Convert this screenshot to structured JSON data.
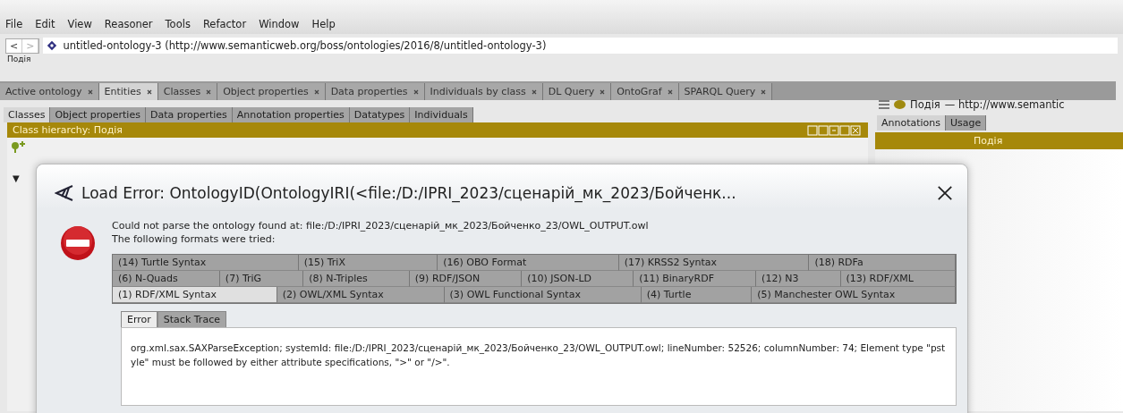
{
  "menu": [
    "File",
    "Edit",
    "View",
    "Reasoner",
    "Tools",
    "Refactor",
    "Window",
    "Help"
  ],
  "nav": {
    "back": "<",
    "forward": ">",
    "ontology": "untitled-ontology-3 (http://www.semanticweb.org/boss/ontologies/2016/8/untitled-ontology-3)",
    "breadcrumb": "Подія"
  },
  "tabs": [
    {
      "label": "Active ontology",
      "selected": false
    },
    {
      "label": "Entities",
      "selected": true
    },
    {
      "label": "Classes",
      "selected": false
    },
    {
      "label": "Object properties",
      "selected": false
    },
    {
      "label": "Data properties",
      "selected": false
    },
    {
      "label": "Individuals by class",
      "selected": false
    },
    {
      "label": "DL Query",
      "selected": false
    },
    {
      "label": "OntoGraf",
      "selected": false
    },
    {
      "label": "SPARQL Query",
      "selected": false
    }
  ],
  "subtabs": [
    {
      "label": "Classes",
      "selected": true
    },
    {
      "label": "Object properties",
      "selected": false
    },
    {
      "label": "Data properties",
      "selected": false
    },
    {
      "label": "Annotation properties",
      "selected": false
    },
    {
      "label": "Datatypes",
      "selected": false
    },
    {
      "label": "Individuals",
      "selected": false
    }
  ],
  "class_hierarchy": {
    "title": "Class hierarchy: Подія",
    "toggle": "▼"
  },
  "entity": {
    "name": "Подія",
    "iri": "— http://www.semantic",
    "color": "#a08a10"
  },
  "annotation_tabs": [
    {
      "label": "Annotations",
      "selected": true
    },
    {
      "label": "Usage",
      "selected": false
    }
  ],
  "annotation_header": "Подія",
  "dialog": {
    "title": "Load Error: OntologyID(OntologyIRI(<file:/D:/IPRI_2023/сценарій_мк_2023/Бойченк...",
    "message": [
      "Could not parse the ontology found at: file:/D:/IPRI_2023/сценарій_мк_2023/Бойченко_23/OWL_OUTPUT.owl",
      "The following formats were tried:"
    ],
    "format_rows": [
      [
        {
          "label": "(14) Turtle Syntax",
          "selected": false
        },
        {
          "label": "(15) TriX",
          "selected": false
        },
        {
          "label": "(16) OBO Format",
          "selected": false
        },
        {
          "label": "(17) KRSS2 Syntax",
          "selected": false
        },
        {
          "label": "(18) RDFa",
          "selected": false
        }
      ],
      [
        {
          "label": "(6) N-Quads",
          "selected": false
        },
        {
          "label": "(7) TriG",
          "selected": false
        },
        {
          "label": "(8) N-Triples",
          "selected": false
        },
        {
          "label": "(9) RDF/JSON",
          "selected": false
        },
        {
          "label": "(10) JSON-LD",
          "selected": false
        },
        {
          "label": "(11) BinaryRDF",
          "selected": false
        },
        {
          "label": "(12) N3",
          "selected": false
        },
        {
          "label": "(13) RDF/XML",
          "selected": false
        }
      ],
      [
        {
          "label": "(1) RDF/XML Syntax",
          "selected": true
        },
        {
          "label": "(2) OWL/XML Syntax",
          "selected": false
        },
        {
          "label": "(3) OWL Functional Syntax",
          "selected": false
        },
        {
          "label": "(4) Turtle",
          "selected": false
        },
        {
          "label": "(5) Manchester OWL Syntax",
          "selected": false
        }
      ]
    ],
    "error_tabs": [
      {
        "label": "Error",
        "selected": true
      },
      {
        "label": "Stack Trace",
        "selected": false
      }
    ],
    "error_text": "org.xml.sax.SAXParseException; systemId: file:/D:/IPRI_2023/сценарій_мк_2023/Бойченко_23/OWL_OUTPUT.owl; lineNumber: 52526; columnNumber: 74; Element type \"pstyle\" must be followed by either attribute specifications, \">\" or \"/>\"."
  }
}
